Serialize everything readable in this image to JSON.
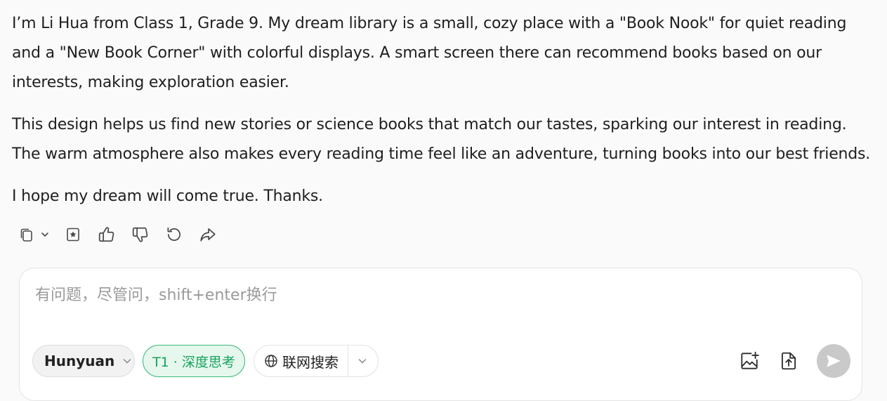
{
  "message": {
    "paragraphs": [
      "I’m Li Hua from Class 1, Grade 9. My dream library is a small, cozy place with a \"Book Nook\" for quiet reading and a \"New Book Corner\" with colorful displays. A smart screen there can recommend books based on our interests, making exploration easier.",
      "This design helps us find new stories or science books that match our tastes, sparking our interest in reading. The warm atmosphere also makes every reading time feel like an adventure, turning books into our best friends.",
      "I hope my dream will come true. Thanks."
    ]
  },
  "actions": {
    "icons": [
      "copy-icon",
      "chevron-down-icon",
      "bookmark-star-icon",
      "thumbs-up-icon",
      "thumbs-down-icon",
      "regenerate-icon",
      "share-icon"
    ]
  },
  "composer": {
    "placeholder": "有问题，尽管问，shift+enter换行",
    "value": "",
    "model_label": "Hunyuan",
    "think_label": "T1 · 深度思考",
    "search_label": "联网搜索"
  },
  "colors": {
    "background": "#fafafa",
    "think_accent": "#17a35c",
    "think_bg": "#e6f7ee",
    "send_disabled": "#c9c9c9"
  }
}
